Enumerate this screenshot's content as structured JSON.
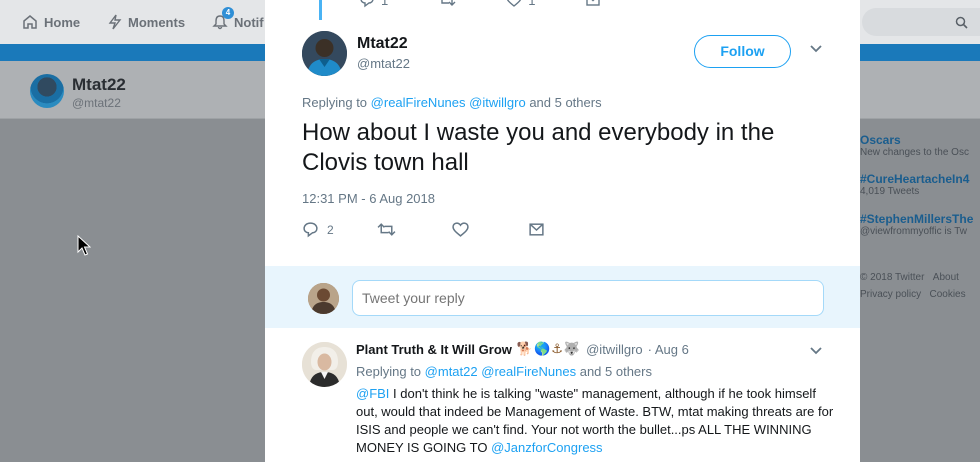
{
  "background": {
    "nav": {
      "home": "Home",
      "moments": "Moments",
      "notifications": "Notif",
      "notification_count": "4"
    },
    "profile": {
      "name": "Mtat22",
      "handle": "@mtat22"
    },
    "trends": [
      {
        "title": "Oscars",
        "subtitle": "New changes to the Osc"
      },
      {
        "title": "#CureHeartacheIn4",
        "subtitle": "4,019 Tweets"
      },
      {
        "title": "#StephenMillersThe",
        "subtitle": "@viewfrommyoffic is Tw"
      }
    ],
    "footer": {
      "copyright": "© 2018 Twitter",
      "about": "About",
      "privacy": "Privacy policy",
      "cookies": "Cookies"
    }
  },
  "previous_tweet_actions": {
    "reply_count": "1",
    "like_count": "1"
  },
  "tweet": {
    "name": "Mtat22",
    "handle": "@mtat22",
    "follow_label": "Follow",
    "replying_prefix": "Replying to",
    "replying_to": [
      "@realFireNunes",
      "@itwillgro"
    ],
    "replying_suffix": "and 5 others",
    "text": "How about I waste you and everybody in the Clovis town hall",
    "timestamp": "12:31 PM - 6 Aug 2018",
    "reply_count": "2"
  },
  "reply_box": {
    "placeholder": "Tweet your reply"
  },
  "reply": {
    "name": "Plant Truth & It Will Grow",
    "emojis": "🐕🌎⚓🐺",
    "handle": "@itwillgro",
    "date": "· Aug 6",
    "replying_prefix": "Replying to",
    "replying_to": [
      "@mtat22",
      "@realFireNunes"
    ],
    "replying_suffix": "and 5 others",
    "mention_start": "@FBI",
    "text": " I don't think he is talking \"waste\" management, although if he took himself out, would that indeed be Management of Waste. BTW, mtat making threats are for ISIS and people we can't find. Your not worth the bullet...ps ALL THE WINNING MONEY IS GOING TO ",
    "mention_end": "@JanzforCongress"
  },
  "colors": {
    "accent": "#1da1f2",
    "text_primary": "#14171a",
    "text_secondary": "#657786",
    "reply_bar": "#e8f5fd"
  }
}
